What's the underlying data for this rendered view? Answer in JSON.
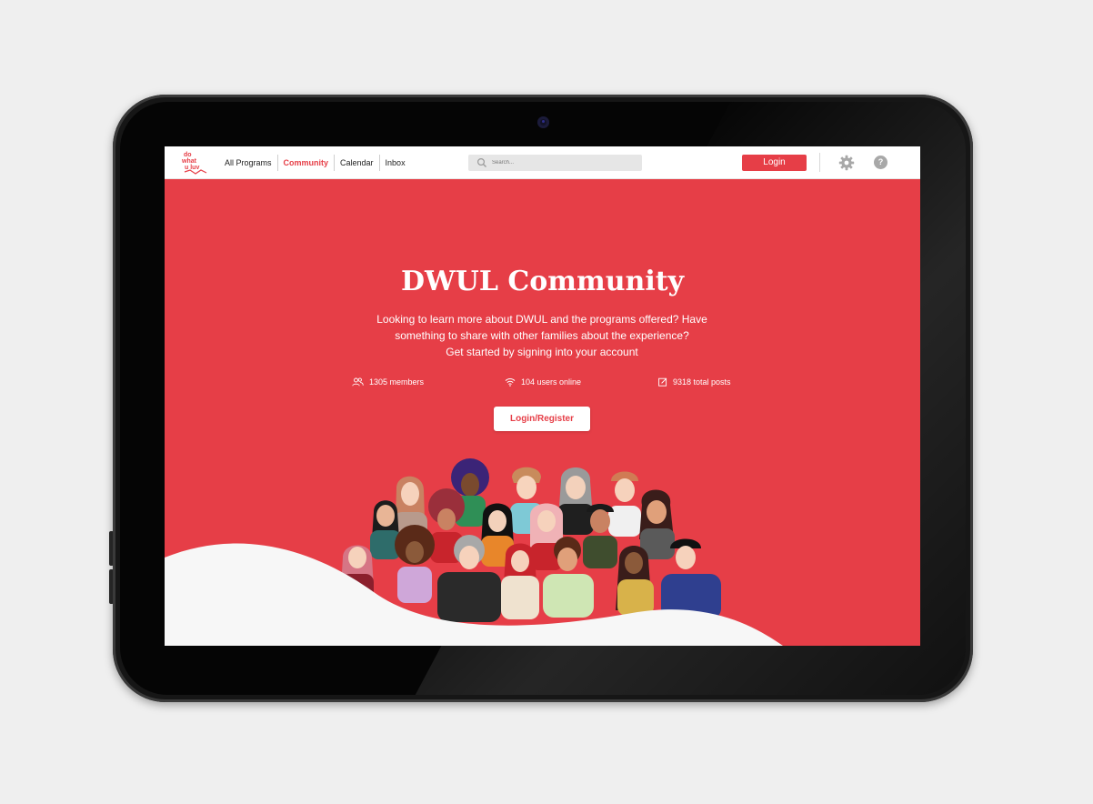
{
  "app": {
    "logo_text": "do what u luv"
  },
  "nav": {
    "links": [
      {
        "label": "All Programs",
        "active": false
      },
      {
        "label": "Community",
        "active": true
      },
      {
        "label": "Calendar",
        "active": false
      },
      {
        "label": "Inbox",
        "active": false
      }
    ],
    "search": {
      "placeholder": "Search..."
    },
    "login_label": "Login",
    "help_label": "?"
  },
  "hero": {
    "title": "DWUL Community",
    "description_lines": [
      "Looking to learn more about DWUL and the programs offered? Have",
      "something to share with other families about the experience?",
      "Get started by signing into your account"
    ],
    "stats": [
      {
        "icon": "members-icon",
        "text": "1305 members"
      },
      {
        "icon": "wifi-icon",
        "text": "104 users online"
      },
      {
        "icon": "edit-icon",
        "text": "9318 total posts"
      }
    ],
    "cta_label": "Login/Register"
  },
  "colors": {
    "brand": "#e63e47",
    "nav_bg": "#ffffff",
    "search_bg": "#e6e6e6",
    "wave": "#f7f7f7"
  }
}
